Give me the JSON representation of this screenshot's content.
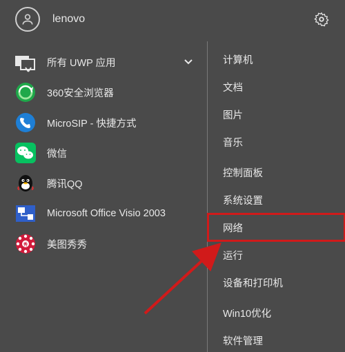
{
  "user": {
    "name": "lenovo"
  },
  "apps_header": {
    "label": "所有 UWP 应用"
  },
  "apps": [
    {
      "label": "360安全浏览器"
    },
    {
      "label": "MicroSIP - 快捷方式"
    },
    {
      "label": "微信"
    },
    {
      "label": "腾讯QQ"
    },
    {
      "label": "Microsoft Office Visio 2003"
    },
    {
      "label": "美图秀秀"
    }
  ],
  "places": [
    {
      "label": "计算机"
    },
    {
      "label": "文档"
    },
    {
      "label": "图片"
    },
    {
      "label": "音乐"
    },
    {
      "label": "控制面板"
    },
    {
      "label": "系统设置"
    },
    {
      "label": "网络",
      "highlight": true
    },
    {
      "label": "运行"
    },
    {
      "label": "设备和打印机"
    },
    {
      "label": "Win10优化"
    },
    {
      "label": "软件管理"
    }
  ]
}
